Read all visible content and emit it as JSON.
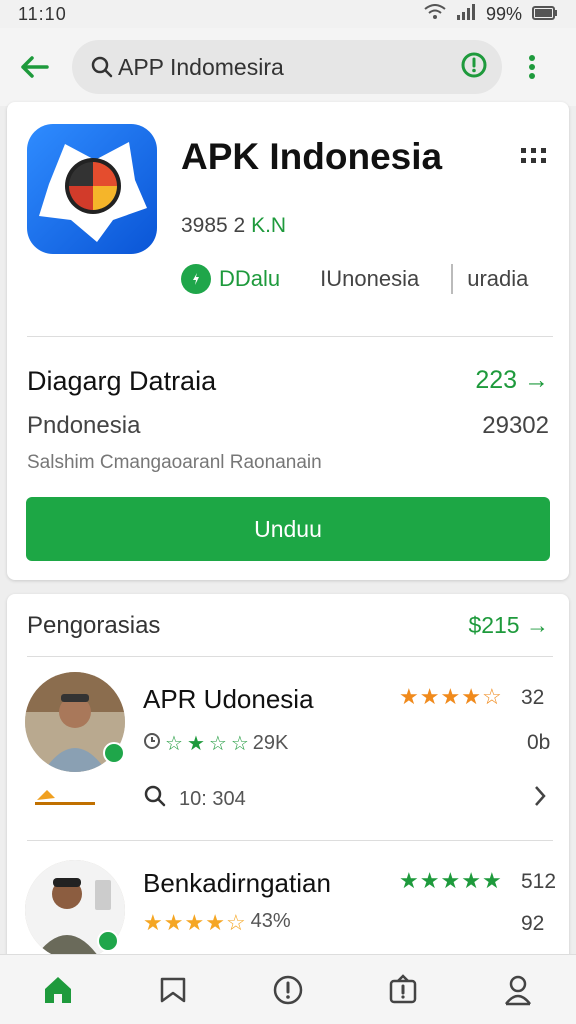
{
  "status_bar": {
    "time": "11:10",
    "battery": "99%"
  },
  "search": {
    "query": "APP Indomesira"
  },
  "app": {
    "title": "APK Indonesia",
    "downloads": "3985 2",
    "downloads_unit": "K.N",
    "tag_verified": "DDalu",
    "tag_region": "IUnonesia",
    "tag_lang": "uradia"
  },
  "details": {
    "title": "Diagarg Datraia",
    "count": "223",
    "subtitle": "Pndonesia",
    "number": "29302",
    "description": "Salshim Cmangaoaranl Raonanain",
    "install_label": "Unduu"
  },
  "reviews": {
    "header": "Pengorasias",
    "header_link": "$215",
    "items": [
      {
        "name": "APR Udonesia",
        "score": "32",
        "sub_score": "29K",
        "right_value": "0b",
        "meta": "10: 304",
        "rating": 4
      },
      {
        "name": "Benkadirngatian",
        "score": "512",
        "sub_score": "43%",
        "right_value": "92",
        "rating": 5
      }
    ]
  },
  "colors": {
    "accent": "#1da745",
    "rating_orange": "#f08a1c",
    "app_icon_blue": "#1f76f0"
  }
}
